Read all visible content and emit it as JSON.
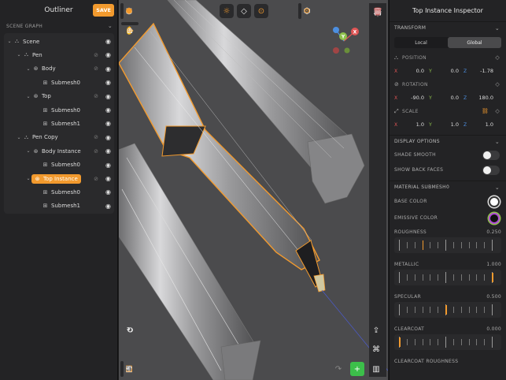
{
  "outliner": {
    "title": "Outliner",
    "save_label": "SAVE",
    "scene_graph_label": "SCENE GRAPH",
    "rows": [
      {
        "label": "Scene",
        "depth": 0,
        "icon": "scene-icon",
        "icon_glyph": "⛬",
        "has_arrow": true,
        "selected": false,
        "hidden_toggle": false
      },
      {
        "label": "Pen",
        "depth": 1,
        "icon": "node-icon",
        "icon_glyph": "⛬",
        "has_arrow": true,
        "selected": false,
        "hidden_toggle": true
      },
      {
        "label": "Body",
        "depth": 2,
        "icon": "instance-icon",
        "icon_glyph": "⊛",
        "has_arrow": true,
        "selected": false,
        "hidden_toggle": true
      },
      {
        "label": "Submesh0",
        "depth": 3,
        "icon": "mesh-icon",
        "icon_glyph": "⊞",
        "has_arrow": false,
        "selected": false,
        "hidden_toggle": false
      },
      {
        "label": "Top",
        "depth": 2,
        "icon": "instance-icon",
        "icon_glyph": "⊛",
        "has_arrow": true,
        "selected": false,
        "hidden_toggle": true
      },
      {
        "label": "Submesh0",
        "depth": 3,
        "icon": "mesh-icon",
        "icon_glyph": "⊞",
        "has_arrow": false,
        "selected": false,
        "hidden_toggle": false
      },
      {
        "label": "Submesh1",
        "depth": 3,
        "icon": "mesh-icon",
        "icon_glyph": "⊞",
        "has_arrow": false,
        "selected": false,
        "hidden_toggle": false
      },
      {
        "label": "Pen Copy",
        "depth": 1,
        "icon": "node-icon",
        "icon_glyph": "⛬",
        "has_arrow": true,
        "selected": false,
        "hidden_toggle": true
      },
      {
        "label": "Body Instance",
        "depth": 2,
        "icon": "instance-icon",
        "icon_glyph": "⊛",
        "has_arrow": true,
        "selected": false,
        "hidden_toggle": true
      },
      {
        "label": "Submesh0",
        "depth": 3,
        "icon": "mesh-icon",
        "icon_glyph": "⊞",
        "has_arrow": false,
        "selected": false,
        "hidden_toggle": false
      },
      {
        "label": "Top Instance",
        "depth": 2,
        "icon": "instance-icon",
        "icon_glyph": "⊛",
        "has_arrow": true,
        "selected": true,
        "hidden_toggle": true
      },
      {
        "label": "Submesh0",
        "depth": 3,
        "icon": "mesh-icon",
        "icon_glyph": "⊞",
        "has_arrow": false,
        "selected": false,
        "hidden_toggle": false
      },
      {
        "label": "Submesh1",
        "depth": 3,
        "icon": "mesh-icon",
        "icon_glyph": "⊞",
        "has_arrow": false,
        "selected": false,
        "hidden_toggle": false
      }
    ]
  },
  "gizmo": {
    "x_label": "X",
    "y_label": "Y",
    "z_label": "Z"
  },
  "inspector": {
    "title": "Top Instance Inspector",
    "transform_label": "TRANSFORM",
    "local_label": "Local",
    "global_label": "Global",
    "position_label": "POSITION",
    "position": {
      "x": "0.0",
      "y": "0.0",
      "z": "-1.78"
    },
    "rotation_label": "ROTATION",
    "rotation": {
      "x": "-90.0",
      "y": "0.0",
      "z": "180.0"
    },
    "scale_label": "SCALE",
    "scale": {
      "x": "1.0",
      "y": "1.0",
      "z": "1.0"
    },
    "axis_x": "X",
    "axis_y": "Y",
    "axis_z": "Z",
    "display_options_label": "DISPLAY OPTIONS",
    "shade_smooth_label": "SHADE SMOOTH",
    "show_back_faces_label": "SHOW BACK FACES",
    "material_label": "MATERIAL  SUBMESH0",
    "base_color_label": "BASE COLOR",
    "emissive_color_label": "EMISSIVE COLOR",
    "roughness_label": "ROUGHNESS",
    "roughness_value": "0.250",
    "roughness": 0.25,
    "metallic_label": "METALLIC",
    "metallic_value": "1.000",
    "metallic": 1.0,
    "specular_label": "SPECULAR",
    "specular_value": "0.500",
    "specular": 0.5,
    "clearcoat_label": "CLEARCOAT",
    "clearcoat_value": "0.000",
    "clearcoat": 0.0,
    "clearcoat_roughness_label": "CLEARCOAT ROUGHNESS"
  },
  "colors": {
    "accent": "#f29a2e",
    "axis_x": "#e05555",
    "axis_y": "#8fc14c",
    "axis_z": "#4c8fe0"
  }
}
